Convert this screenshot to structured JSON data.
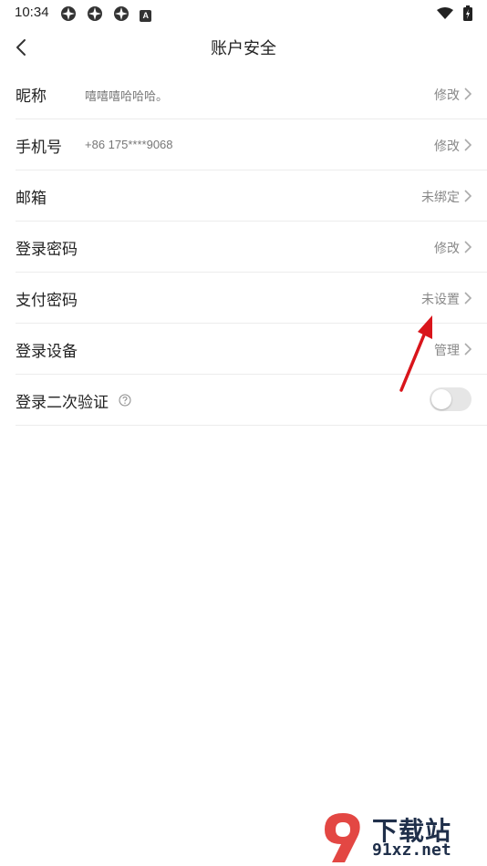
{
  "status_bar": {
    "time": "10:34",
    "notification_icons": [
      "app-notification-icon",
      "app-notification-icon",
      "app-notification-icon",
      "a-notification-icon"
    ],
    "a_icon_text": "A"
  },
  "header": {
    "title": "账户安全"
  },
  "rows": [
    {
      "label": "昵称",
      "value": "嘻嘻嘻哈哈哈。",
      "action": "修改"
    },
    {
      "label": "手机号",
      "value": "+86 175****9068",
      "action": "修改"
    },
    {
      "label": "邮箱",
      "value": "",
      "action": "未绑定"
    },
    {
      "label": "登录密码",
      "value": "",
      "action": "修改"
    },
    {
      "label": "支付密码",
      "value": "",
      "action": "未设置"
    },
    {
      "label": "登录设备",
      "value": "",
      "action": "管理"
    },
    {
      "label": "登录二次验证",
      "help_icon": "question-circle-icon",
      "toggle_on": false
    }
  ],
  "colors": {
    "annotation_arrow": "#d9151b",
    "watermark_red": "#e0332f",
    "watermark_dark": "#1f2f4a"
  },
  "watermark": {
    "cn": "下载站",
    "en": "91xz.net"
  }
}
